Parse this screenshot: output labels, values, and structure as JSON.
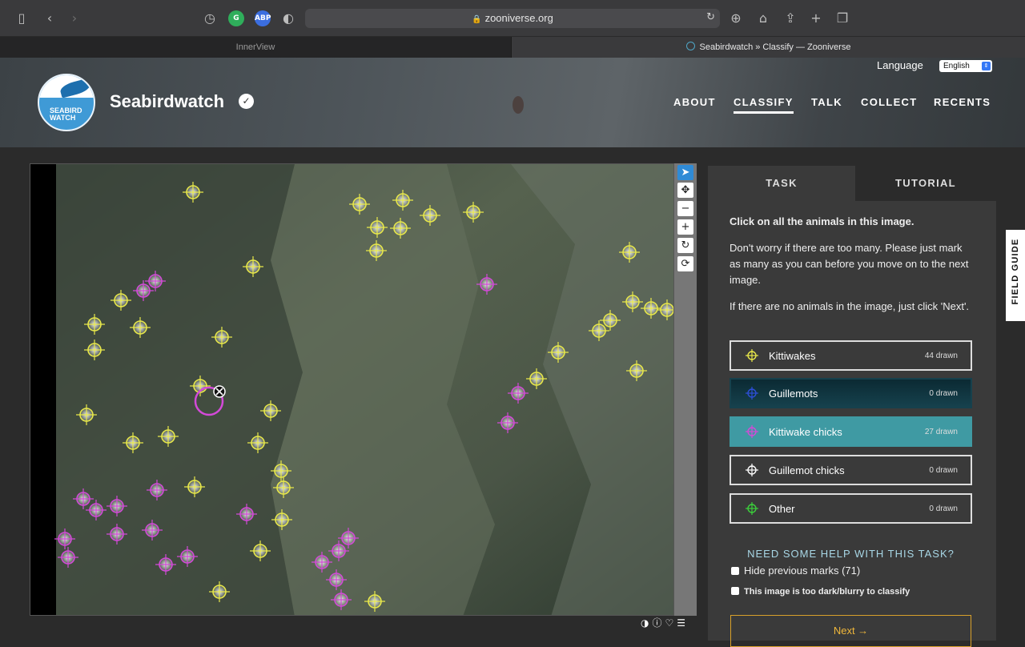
{
  "browser": {
    "url": "zooniverse.org",
    "tabs": [
      {
        "label": "InnerView"
      },
      {
        "label": "Seabirdwatch » Classify — Zooniverse"
      }
    ],
    "extensions": [
      "G",
      "ABP"
    ]
  },
  "header": {
    "logo_text_line1": "SEABIRD",
    "logo_text_line2": "WATCH",
    "title": "Seabirdwatch",
    "nav": [
      "ABOUT",
      "CLASSIFY",
      "TALK",
      "COLLECT",
      "RECENTS"
    ],
    "current_nav": "CLASSIFY",
    "language_label": "Language",
    "language_value": "English"
  },
  "colors": {
    "kittiwake": "#e8e84a",
    "guillemot": "#2d4fd8",
    "kittiwake_chick": "#d34ad8",
    "guillemot_chick": "#ffffff",
    "other": "#3bd13b",
    "next_accent": "#f0b73a"
  },
  "task_panel": {
    "tabs": [
      "TASK",
      "TUTORIAL"
    ],
    "instruction": "Click on all the animals in this image.",
    "paragraph1": "Don't worry if there are too many. Please just mark as many as you can before you move on to the next image.",
    "paragraph2": "If there are no animals in the image, just click 'Next'.",
    "choices": [
      {
        "label": "Kittiwakes",
        "count": "44 drawn",
        "color_key": "kittiwake",
        "state": "normal"
      },
      {
        "label": "Guillemots",
        "count": "0 drawn",
        "color_key": "guillemot",
        "state": "dark"
      },
      {
        "label": "Kittiwake chicks",
        "count": "27 drawn",
        "color_key": "kittiwake_chick",
        "state": "teal"
      },
      {
        "label": "Guillemot chicks",
        "count": "0 drawn",
        "color_key": "guillemot_chick",
        "state": "normal"
      },
      {
        "label": "Other",
        "count": "0 drawn",
        "color_key": "other",
        "state": "normal"
      }
    ],
    "help_title": "NEED SOME HELP WITH THIS TASK?",
    "hide_marks_label": "Hide previous marks (71)",
    "too_dark_label": "This image is too dark/blurry to classify",
    "next_label": "Next →"
  },
  "field_guide": "FIELD GUIDE",
  "toolbar_icons": [
    "pointer-icon",
    "move-icon",
    "zoom-out-icon",
    "zoom-in-icon",
    "rotate-icon",
    "reset-icon"
  ]
}
